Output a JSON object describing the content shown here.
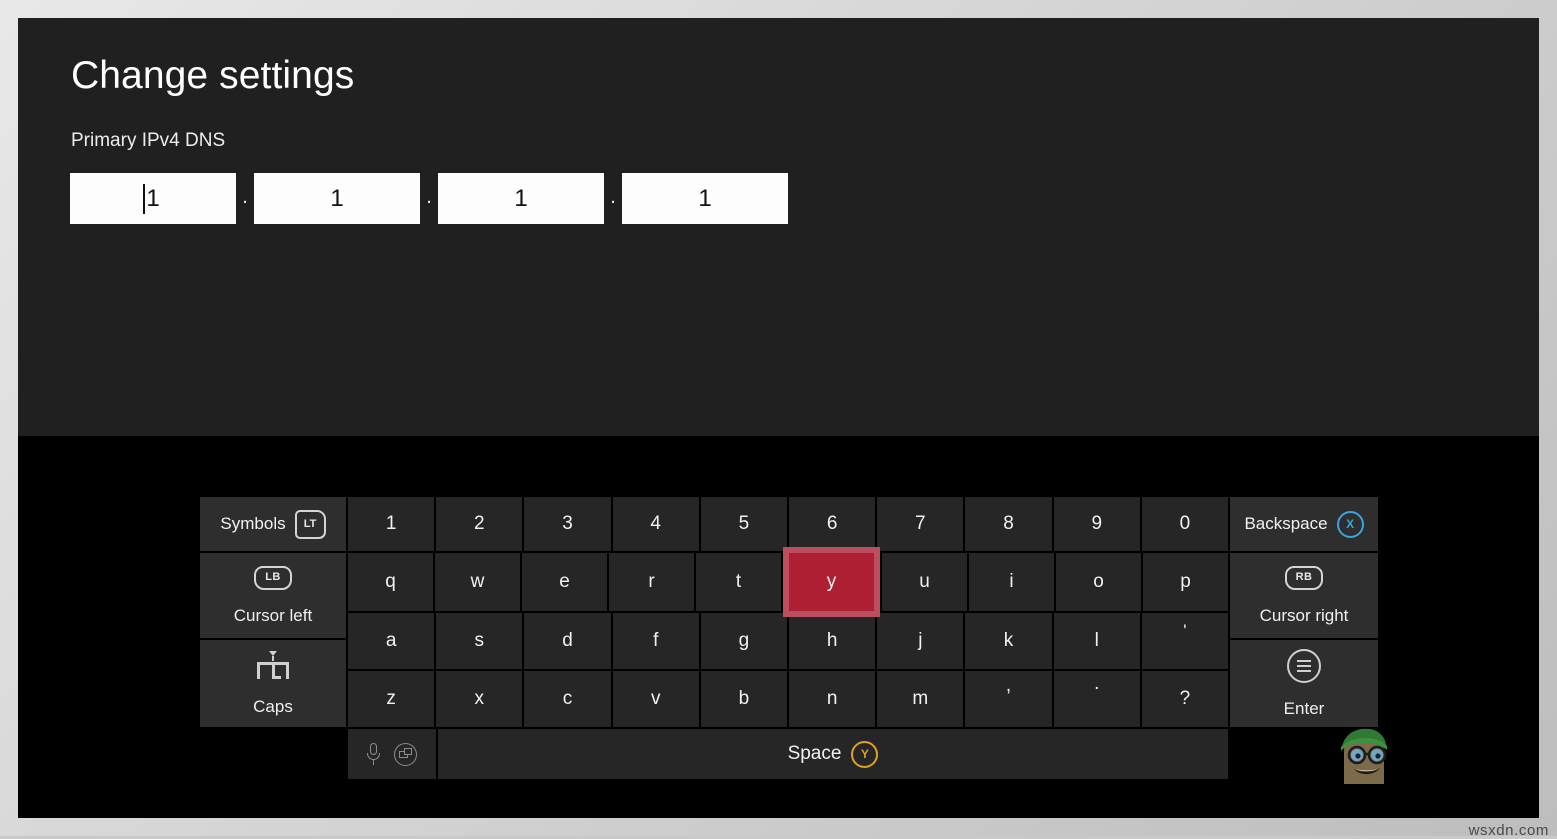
{
  "settings": {
    "title": "Change settings",
    "field_label": "Primary IPv4 DNS",
    "octets": [
      {
        "value": "1",
        "focused": true
      },
      {
        "value": "1",
        "focused": false
      },
      {
        "value": "1",
        "focused": false
      },
      {
        "value": "1",
        "focused": false
      }
    ],
    "separator": "."
  },
  "keyboard": {
    "symbols_key": {
      "label": "Symbols",
      "badge": "LT",
      "icon": "trigger-lt-icon"
    },
    "backspace_key": {
      "label": "Backspace",
      "badge": "X",
      "icon": "button-x-icon"
    },
    "cursor_left_key": {
      "label": "Cursor left",
      "badge": "LB",
      "icon": "bumper-lb-icon"
    },
    "cursor_right_key": {
      "label": "Cursor right",
      "badge": "RB",
      "icon": "bumper-rb-icon"
    },
    "caps_key": {
      "label": "Caps",
      "icon": "caps-lock-icon"
    },
    "enter_key": {
      "label": "Enter",
      "icon": "menu-circle-icon"
    },
    "space_key": {
      "label": "Space",
      "badge": "Y",
      "icon": "button-y-icon"
    },
    "aux_icons": [
      "microphone-icon",
      "layout-switch-icon"
    ],
    "number_row": [
      "1",
      "2",
      "3",
      "4",
      "5",
      "6",
      "7",
      "8",
      "9",
      "0"
    ],
    "row_q": [
      "q",
      "w",
      "e",
      "r",
      "t",
      "y",
      "u",
      "i",
      "o",
      "p"
    ],
    "row_a": [
      "a",
      "s",
      "d",
      "f",
      "g",
      "h",
      "j",
      "k",
      "l",
      "'"
    ],
    "row_z": [
      "z",
      "x",
      "c",
      "v",
      "b",
      "n",
      "m",
      ",",
      ".",
      "?"
    ],
    "active_key": "y",
    "colors": {
      "active_fill": "#ae1f33",
      "active_border": "#bd4e5f",
      "key_face": "#262626",
      "modifier_face": "#2e2e2e",
      "panel_bg": "#202020",
      "keyboard_bg": "#000000",
      "x_button": "#3aa5dc",
      "y_button": "#e0a020"
    }
  },
  "watermark": "wsxdn.com"
}
